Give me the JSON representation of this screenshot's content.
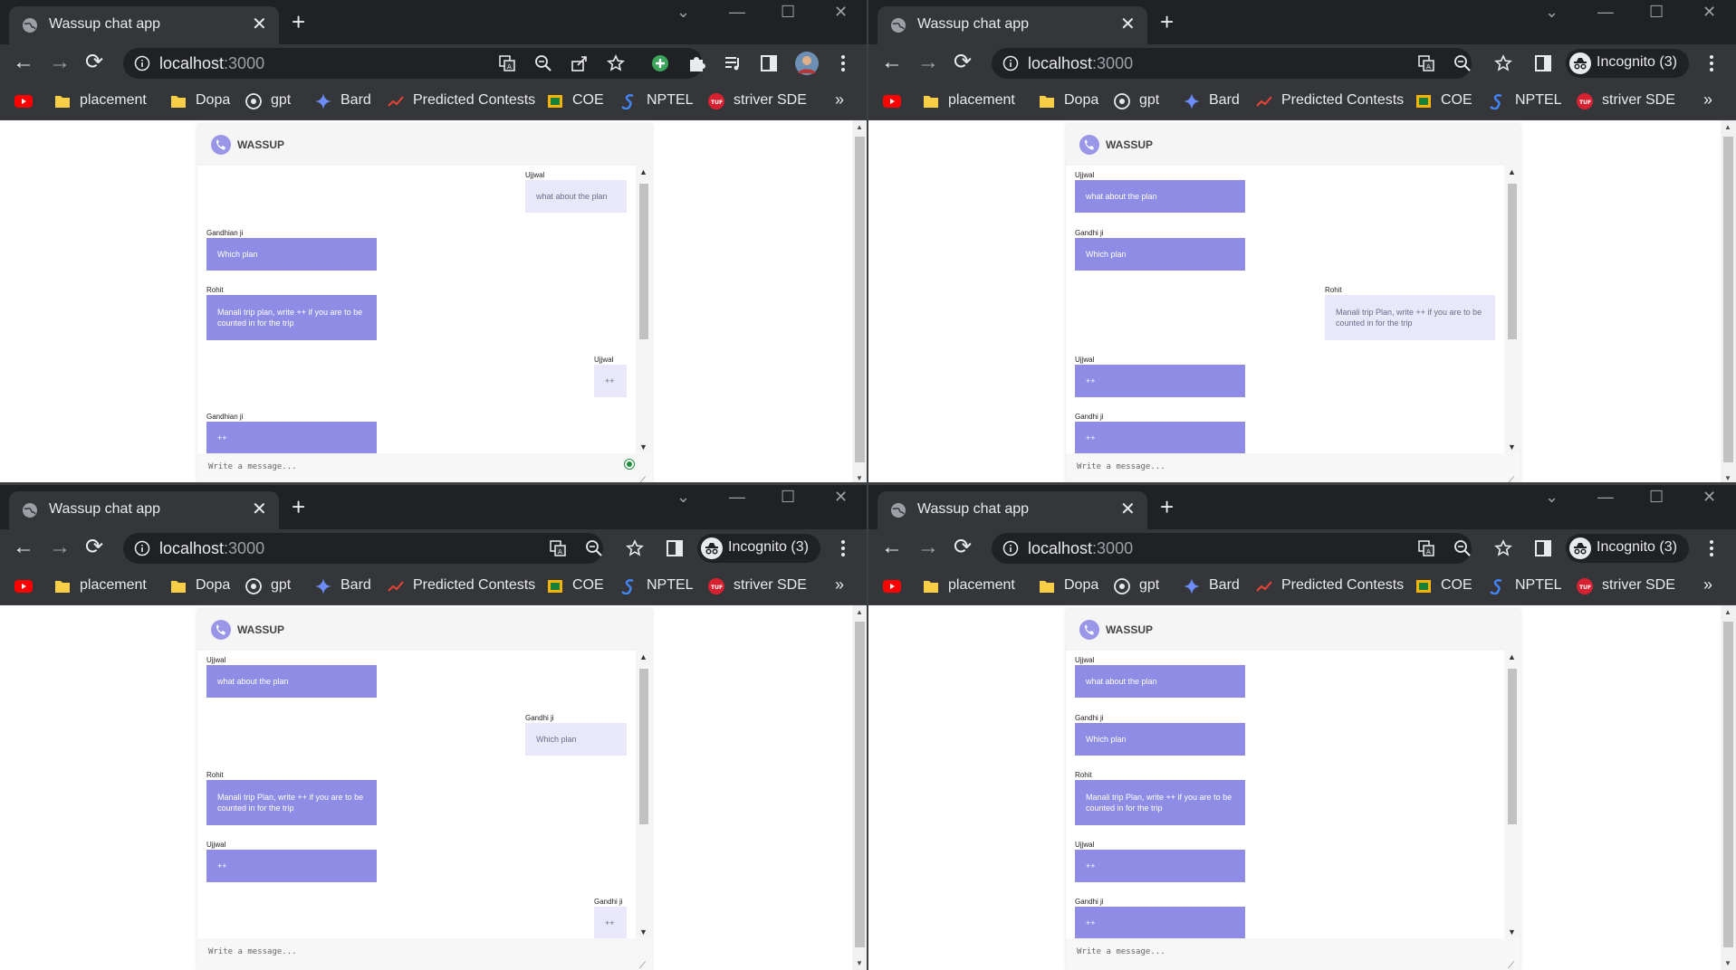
{
  "tab": {
    "title": "Wassup chat app"
  },
  "address": {
    "url_host": "localhost",
    "url_port": ":3000"
  },
  "incognito": {
    "label": "Incognito (3)"
  },
  "bookmarks": [
    "placement",
    "Dopa",
    "gpt",
    "Bard",
    "Predicted Contests",
    "COE",
    "NPTEL",
    "striver SDE"
  ],
  "app": {
    "name": "WASSUP",
    "input_placeholder": "Write a message..."
  },
  "windows": [
    {
      "messages": [
        {
          "sender": "Ujjwal",
          "text": "what about the plan",
          "side": "right",
          "style": "other"
        },
        {
          "sender": "Gandhian ji",
          "text": "Which plan",
          "side": "left",
          "style": "me"
        },
        {
          "sender": "Rohit",
          "text": "Manali trip plan, write ++ if you are to be counted in for the trip",
          "side": "left",
          "style": "me"
        },
        {
          "sender": "Ujjwal",
          "text": "++",
          "side": "right",
          "style": "other"
        },
        {
          "sender": "Gandhian ji",
          "text": "++",
          "side": "left",
          "style": "me"
        }
      ]
    },
    {
      "messages": [
        {
          "sender": "Ujjwal",
          "text": "what about the plan",
          "side": "left",
          "style": "me"
        },
        {
          "sender": "Gandhi ji",
          "text": "Which plan",
          "side": "left",
          "style": "me"
        },
        {
          "sender": "Rohit",
          "text": "Manali trip Plan, write ++ if you are to be counted in for the trip",
          "side": "right",
          "style": "other"
        },
        {
          "sender": "Ujjwal",
          "text": "++",
          "side": "left",
          "style": "me"
        },
        {
          "sender": "Gandhi ji",
          "text": "++",
          "side": "left",
          "style": "me"
        }
      ]
    },
    {
      "messages": [
        {
          "sender": "Ujjwal",
          "text": "what about the plan",
          "side": "left",
          "style": "me"
        },
        {
          "sender": "Gandhi ji",
          "text": "Which plan",
          "side": "right",
          "style": "other"
        },
        {
          "sender": "Rohit",
          "text": "Manali trip Plan, write ++ if you are to be counted in for the trip",
          "side": "left",
          "style": "me"
        },
        {
          "sender": "Ujjwal",
          "text": "++",
          "side": "left",
          "style": "me"
        },
        {
          "sender": "Gandhi ji",
          "text": "++",
          "side": "right",
          "style": "other"
        }
      ]
    },
    {
      "messages": [
        {
          "sender": "Ujjwal",
          "text": "what about the plan",
          "side": "left",
          "style": "me"
        },
        {
          "sender": "Gandhi ji",
          "text": "Which plan",
          "side": "left",
          "style": "me"
        },
        {
          "sender": "Rohit",
          "text": "Manali trip Plan, write ++ if you are to be counted in for the trip",
          "side": "left",
          "style": "me"
        },
        {
          "sender": "Ujjwal",
          "text": "++",
          "side": "left",
          "style": "me"
        },
        {
          "sender": "Gandhi ji",
          "text": "++",
          "side": "left",
          "style": "me"
        }
      ]
    }
  ]
}
